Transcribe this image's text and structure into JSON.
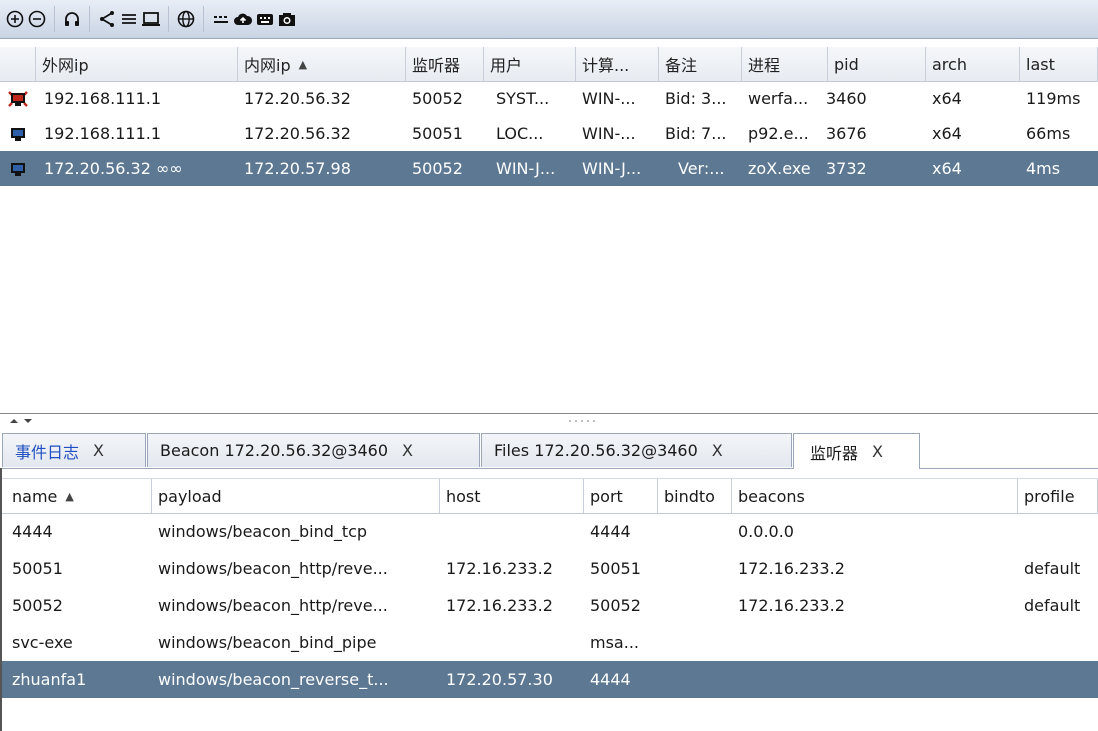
{
  "toolbar": {
    "buttons": [
      "add-icon",
      "remove-icon",
      "headphones-icon",
      "share-icon",
      "list-icon",
      "laptop-icon",
      "globe-icon",
      "keyboard-dots-icon",
      "cloud-upload-icon",
      "keyboard-icon",
      "camera-icon"
    ]
  },
  "beacon_table": {
    "headers": [
      "外网ip",
      "内网ip",
      "监听器",
      "用户",
      "计算...",
      "备注",
      "进程",
      "pid",
      "arch",
      "last"
    ],
    "rows": [
      {
        "external": "192.168.111.1",
        "internal": "172.20.56.32",
        "listener": "50052",
        "user": "SYST...",
        "computer": "WIN-...",
        "note": "Bid: 3...",
        "process": "werfa...",
        "pid": "3460",
        "arch": "x64",
        "last": "119ms"
      },
      {
        "external": "192.168.111.1",
        "internal": "172.20.56.32",
        "listener": "50051",
        "user": "LOC...",
        "computer": "WIN-...",
        "note": "Bid: 7...",
        "process": "p92.e...",
        "pid": "3676",
        "arch": "x64",
        "last": "66ms"
      },
      {
        "external": "172.20.56.32 ∞∞",
        "internal": "172.20.57.98",
        "listener": "50052",
        "user": "WIN-J...",
        "computer": "WIN-J...",
        "note": "Ver:...",
        "process": "zoX.exe",
        "pid": "3732",
        "arch": "x64",
        "last": "4ms"
      }
    ]
  },
  "tabs": [
    {
      "label": "事件日志",
      "close": "X"
    },
    {
      "label": "Beacon 172.20.56.32@3460",
      "close": "X"
    },
    {
      "label": "Files 172.20.56.32@3460",
      "close": "X"
    },
    {
      "label": "监听器",
      "close": "X"
    }
  ],
  "listener_table": {
    "headers": [
      "name",
      "payload",
      "host",
      "port",
      "bindto",
      "beacons",
      "profile"
    ],
    "rows": [
      {
        "name": "4444",
        "payload": "windows/beacon_bind_tcp",
        "host": "",
        "port": "4444",
        "bindto": "",
        "beacons": "0.0.0.0",
        "profile": ""
      },
      {
        "name": "50051",
        "payload": "windows/beacon_http/reve...",
        "host": "172.16.233.2",
        "port": "50051",
        "bindto": "",
        "beacons": "172.16.233.2",
        "profile": "default"
      },
      {
        "name": "50052",
        "payload": "windows/beacon_http/reve...",
        "host": "172.16.233.2",
        "port": "50052",
        "bindto": "",
        "beacons": "172.16.233.2",
        "profile": "default"
      },
      {
        "name": "svc-exe",
        "payload": "windows/beacon_bind_pipe",
        "host": "",
        "port": "msa...",
        "bindto": "",
        "beacons": "",
        "profile": ""
      },
      {
        "name": "zhuanfa1",
        "payload": "windows/beacon_reverse_t...",
        "host": "172.20.57.30",
        "port": "4444",
        "bindto": "",
        "beacons": "",
        "profile": ""
      }
    ]
  },
  "colors": {
    "selected": "#5d7893",
    "active_tab_text": "#1f4fc2",
    "toolbar": "#d3dcea"
  }
}
